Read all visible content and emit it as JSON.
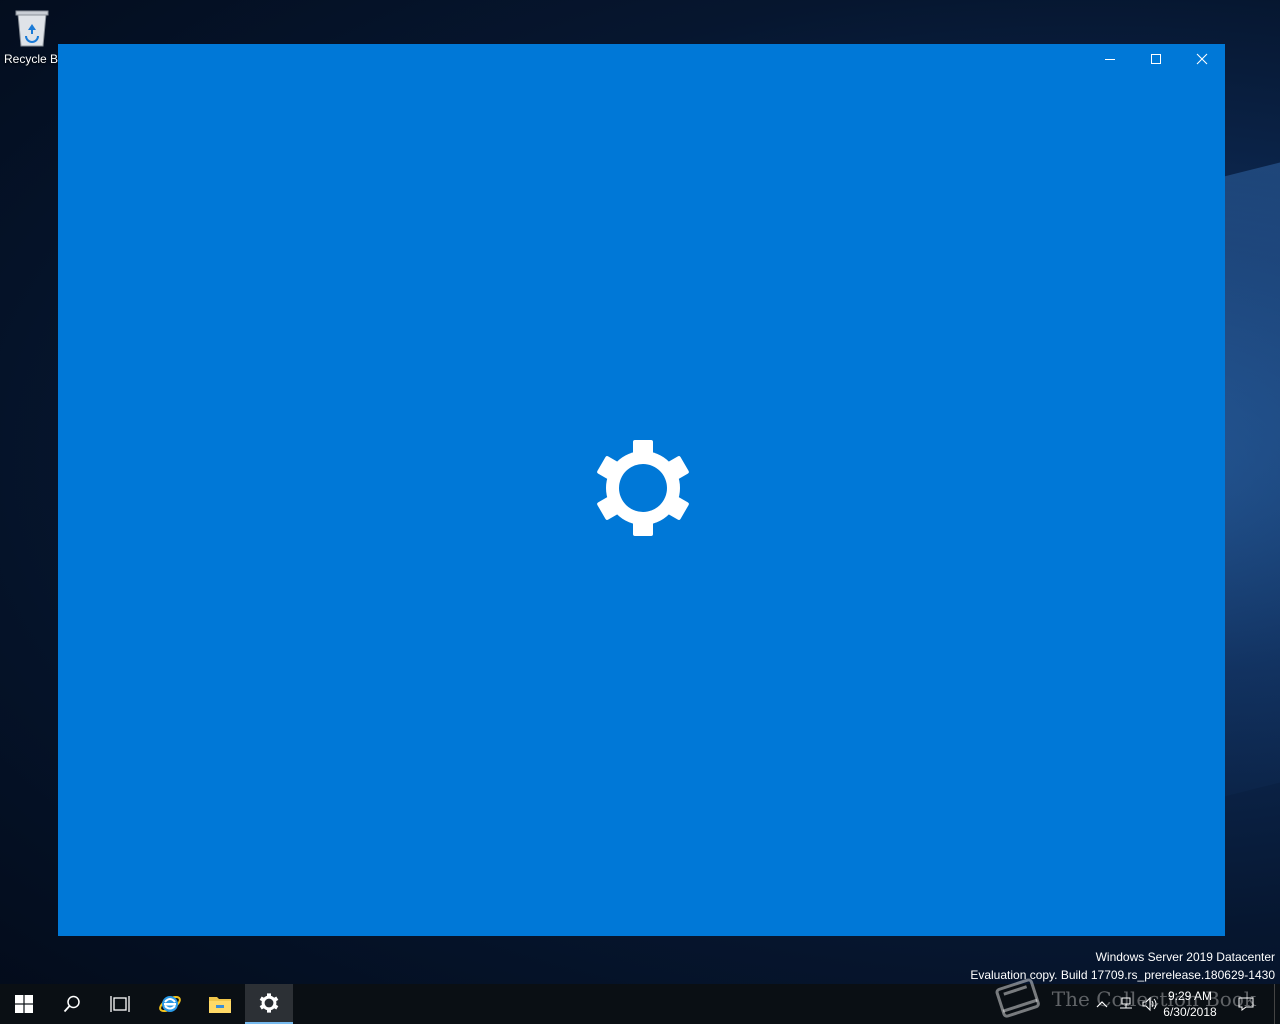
{
  "desktop": {
    "recycle_bin_label": "Recycle Bin"
  },
  "window": {
    "background": "#0078d7",
    "controls": {
      "minimize": "minimize-icon",
      "maximize": "maximize-icon",
      "close": "close-icon"
    },
    "splash_icon": "gear-icon"
  },
  "watermark": {
    "edition": "Windows Server 2019 Datacenter",
    "build": "Evaluation copy. Build 17709.rs_prerelease.180629-1430"
  },
  "taskbar": {
    "background": "#0a0f14",
    "active_indicator": "#76b9ed",
    "buttons": [
      {
        "name": "start-button",
        "icon": "windows-logo-icon"
      },
      {
        "name": "search-button",
        "icon": "search-icon"
      },
      {
        "name": "task-view-button",
        "icon": "task-view-icon"
      },
      {
        "name": "internet-explorer-button",
        "icon": "internet-explorer-icon"
      },
      {
        "name": "file-explorer-button",
        "icon": "folder-icon"
      },
      {
        "name": "settings-button",
        "icon": "gear-icon",
        "active": true
      }
    ],
    "tray": {
      "time": "9:29 AM",
      "date": "6/30/2018",
      "icons": [
        "chevron-up-icon",
        "network-icon",
        "volume-icon",
        "action-center-icon"
      ]
    }
  },
  "overlay_brand": "The Collection Book"
}
